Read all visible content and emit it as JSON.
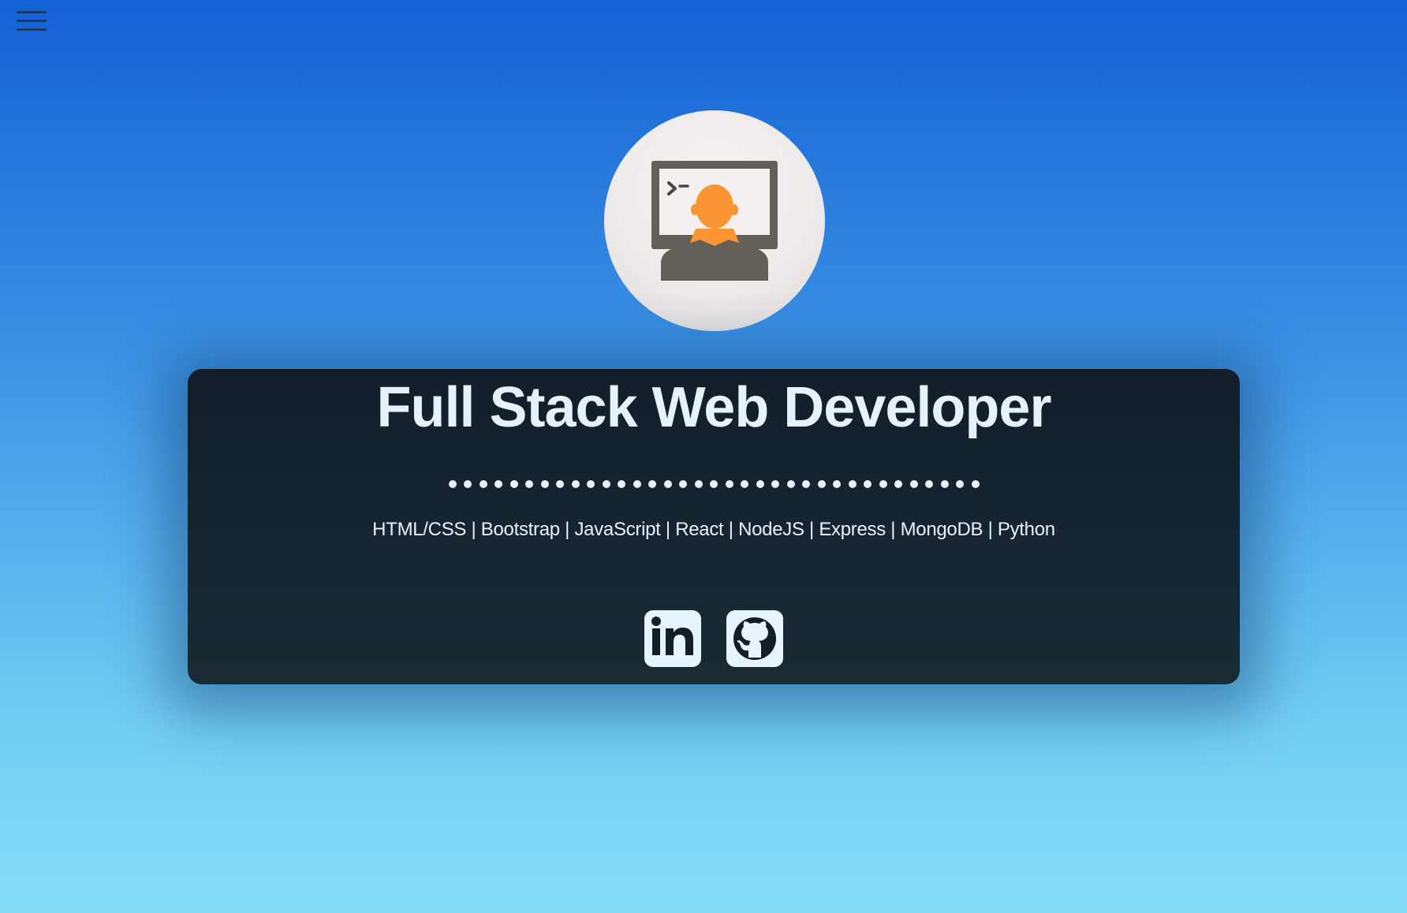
{
  "nav": {
    "menu_icon": "hamburger-menu-icon"
  },
  "profile": {
    "avatar_icon": "developer-at-computer-icon",
    "avatar_colors": {
      "background": "#f2efee",
      "monitor": "#655f5a",
      "person_head": "#fb9432"
    }
  },
  "hero": {
    "title": "Full Stack Web Developer",
    "divider_dot_count": 35,
    "skills": "HTML/CSS | Bootstrap | JavaScript | React | NodeJS | Express | MongoDB | Python"
  },
  "social": [
    {
      "name": "LinkedIn",
      "icon": "linkedin-icon"
    },
    {
      "name": "GitHub",
      "icon": "github-icon"
    }
  ],
  "colors": {
    "background_top": "#1460d6",
    "background_bottom": "#84dcf7",
    "card_background": "#15232e",
    "text": "#e6f2fb"
  }
}
